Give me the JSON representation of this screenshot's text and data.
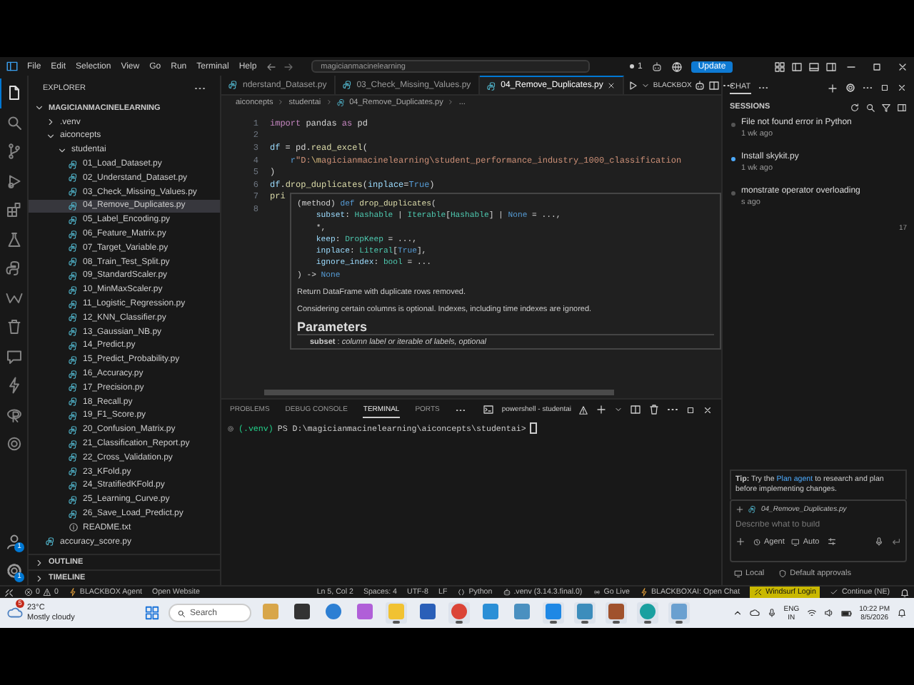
{
  "title_bar": {
    "menu": [
      "File",
      "Edit",
      "Selection",
      "View",
      "Go",
      "Run",
      "Terminal",
      "Help"
    ],
    "search": "magicianmacinelearning",
    "notification_count": "1",
    "update_button": "Update"
  },
  "activity_bar": {
    "items": [
      {
        "kind": "files",
        "selected": true
      },
      {
        "kind": "search",
        "selected": false
      },
      {
        "kind": "branch",
        "selected": false
      },
      {
        "kind": "debug",
        "selected": false
      },
      {
        "kind": "extensions",
        "selected": false
      },
      {
        "kind": "flask",
        "selected": false
      },
      {
        "kind": "python",
        "selected": false
      },
      {
        "kind": "zigzag",
        "selected": false
      },
      {
        "kind": "trash",
        "selected": false
      },
      {
        "kind": "chat",
        "selected": false
      },
      {
        "kind": "bolt",
        "selected": false
      },
      {
        "kind": "rlogo",
        "selected": false
      },
      {
        "kind": "ring",
        "selected": false
      }
    ],
    "bottom": [
      {
        "kind": "account",
        "badge": "1"
      },
      {
        "kind": "gear",
        "badge": "1"
      }
    ]
  },
  "sidebar": {
    "title": "EXPLORER",
    "tree": [
      {
        "label": "MAGICIANMACINELEARNING",
        "kind": "root",
        "expanded": true,
        "selected": false,
        "children": [
          {
            "label": ".venv",
            "kind": "folder",
            "expanded": false,
            "selected": false
          },
          {
            "label": "aiconcepts",
            "kind": "folder",
            "expanded": true,
            "selected": false,
            "children": [
              {
                "label": "studentai",
                "kind": "folder",
                "expanded": true,
                "selected": false,
                "children": [
                  {
                    "label": "01_Load_Dataset.py",
                    "kind": "python",
                    "selected": false
                  },
                  {
                    "label": "02_Understand_Dataset.py",
                    "kind": "python",
                    "selected": false
                  },
                  {
                    "label": "03_Check_Missing_Values.py",
                    "kind": "python",
                    "selected": false
                  },
                  {
                    "label": "04_Remove_Duplicates.py",
                    "kind": "python",
                    "selected": true
                  },
                  {
                    "label": "05_Label_Encoding.py",
                    "kind": "python",
                    "selected": false
                  },
                  {
                    "label": "06_Feature_Matrix.py",
                    "kind": "python",
                    "selected": false
                  },
                  {
                    "label": "07_Target_Variable.py",
                    "kind": "python",
                    "selected": false
                  },
                  {
                    "label": "08_Train_Test_Split.py",
                    "kind": "python",
                    "selected": false
                  },
                  {
                    "label": "09_StandardScaler.py",
                    "kind": "python",
                    "selected": false
                  },
                  {
                    "label": "10_MinMaxScaler.py",
                    "kind": "python",
                    "selected": false
                  },
                  {
                    "label": "11_Logistic_Regression.py",
                    "kind": "python",
                    "selected": false
                  },
                  {
                    "label": "12_KNN_Classifier.py",
                    "kind": "python",
                    "selected": false
                  },
                  {
                    "label": "13_Gaussian_NB.py",
                    "kind": "python",
                    "selected": false
                  },
                  {
                    "label": "14_Predict.py",
                    "kind": "python",
                    "selected": false
                  },
                  {
                    "label": "15_Predict_Probability.py",
                    "kind": "python",
                    "selected": false
                  },
                  {
                    "label": "16_Accuracy.py",
                    "kind": "python",
                    "selected": false
                  },
                  {
                    "label": "17_Precision.py",
                    "kind": "python",
                    "selected": false
                  },
                  {
                    "label": "18_Recall.py",
                    "kind": "python",
                    "selected": false
                  },
                  {
                    "label": "19_F1_Score.py",
                    "kind": "python",
                    "selected": false
                  },
                  {
                    "label": "20_Confusion_Matrix.py",
                    "kind": "python",
                    "selected": false
                  },
                  {
                    "label": "21_Classification_Report.py",
                    "kind": "python",
                    "selected": false
                  },
                  {
                    "label": "22_Cross_Validation.py",
                    "kind": "python",
                    "selected": false
                  },
                  {
                    "label": "23_KFold.py",
                    "kind": "python",
                    "selected": false
                  },
                  {
                    "label": "24_StratifiedKFold.py",
                    "kind": "python",
                    "selected": false
                  },
                  {
                    "label": "25_Learning_Curve.py",
                    "kind": "python",
                    "selected": false
                  },
                  {
                    "label": "26_Save_Load_Predict.py",
                    "kind": "python",
                    "selected": false
                  },
                  {
                    "label": "README.txt",
                    "kind": "text",
                    "selected": false
                  }
                ]
              }
            ]
          },
          {
            "label": "accuracy_score.py",
            "kind": "python",
            "selected": false
          }
        ]
      }
    ],
    "sections": [
      {
        "label": "OUTLINE",
        "expanded": false
      },
      {
        "label": "TIMELINE",
        "expanded": false
      }
    ]
  },
  "editor": {
    "tabs": [
      {
        "label": "nderstand_Dataset.py",
        "selected": false
      },
      {
        "label": "03_Check_Missing_Values.py",
        "selected": false
      },
      {
        "label": "04_Remove_Duplicates.py",
        "selected": true
      }
    ],
    "tab_action": "BLACKBOX",
    "breadcrumb": [
      "aiconcepts",
      "studentai",
      "04_Remove_Duplicates.py",
      "..."
    ],
    "lines": [
      {
        "number": "1",
        "tokens": [
          {
            "kind": "keyword",
            "text": "import"
          },
          {
            "kind": "plain",
            "text": " pandas "
          },
          {
            "kind": "keyword",
            "text": "as"
          },
          {
            "kind": "plain",
            "text": " pd"
          }
        ]
      },
      {
        "number": "2"
      },
      {
        "number": "3",
        "tokens": [
          {
            "kind": "var",
            "text": "df"
          },
          {
            "kind": "plain",
            "text": " = pd."
          },
          {
            "kind": "func",
            "text": "read_excel"
          },
          {
            "kind": "plain",
            "text": "("
          }
        ]
      },
      {
        "number": "4",
        "indented": true,
        "tokens": [
          {
            "kind": "const",
            "text": "r"
          },
          {
            "kind": "string",
            "text": "\"D:"
          },
          {
            "kind": "escape",
            "text": "\\m"
          },
          {
            "kind": "string",
            "text": "agicianmacinelearning\\student_performance_industry_1000_classification"
          }
        ]
      },
      {
        "number": "5",
        "tokens": [
          {
            "kind": "plain",
            "text": ")"
          }
        ]
      },
      {
        "number": "6",
        "tokens": [
          {
            "kind": "var",
            "text": "df"
          },
          {
            "kind": "plain",
            "text": "."
          },
          {
            "kind": "func",
            "text": "drop_duplicates"
          },
          {
            "kind": "plain",
            "text": "("
          },
          {
            "kind": "var",
            "text": "inplace"
          },
          {
            "kind": "plain",
            "text": "="
          },
          {
            "kind": "const",
            "text": "True"
          },
          {
            "kind": "plain",
            "text": ")"
          }
        ]
      },
      {
        "number": "7",
        "tokens": [
          {
            "kind": "func",
            "text": "pri"
          }
        ]
      },
      {
        "number": "8"
      }
    ],
    "hover": {
      "signature": [
        [
          {
            "kind": "plain",
            "text": "(method) "
          },
          {
            "kind": "const",
            "text": "def"
          },
          {
            "kind": "func",
            "text": " drop_duplicates"
          },
          {
            "kind": "plain",
            "text": "("
          }
        ],
        [
          {
            "kind": "var",
            "text": "    subset"
          },
          {
            "kind": "plain",
            "text": ": "
          },
          {
            "kind": "type",
            "text": "Hashable"
          },
          {
            "kind": "plain",
            "text": " | "
          },
          {
            "kind": "type",
            "text": "Iterable"
          },
          {
            "kind": "plain",
            "text": "["
          },
          {
            "kind": "type",
            "text": "Hashable"
          },
          {
            "kind": "plain",
            "text": "] | "
          },
          {
            "kind": "const",
            "text": "None"
          },
          {
            "kind": "plain",
            "text": " = ...,"
          }
        ],
        [
          {
            "kind": "plain",
            "text": "    *,"
          }
        ],
        [
          {
            "kind": "var",
            "text": "    keep"
          },
          {
            "kind": "plain",
            "text": ": "
          },
          {
            "kind": "type",
            "text": "DropKeep"
          },
          {
            "kind": "plain",
            "text": " = ...,"
          }
        ],
        [
          {
            "kind": "var",
            "text": "    inplace"
          },
          {
            "kind": "plain",
            "text": ": "
          },
          {
            "kind": "type",
            "text": "Literal"
          },
          {
            "kind": "plain",
            "text": "["
          },
          {
            "kind": "const",
            "text": "True"
          },
          {
            "kind": "plain",
            "text": "],"
          }
        ],
        [
          {
            "kind": "var",
            "text": "    ignore_index"
          },
          {
            "kind": "plain",
            "text": ": "
          },
          {
            "kind": "type",
            "text": "bool"
          },
          {
            "kind": "plain",
            "text": " = ..."
          }
        ],
        [
          {
            "kind": "plain",
            "text": ") -> "
          },
          {
            "kind": "const",
            "text": "None"
          }
        ]
      ],
      "description": [
        "Return DataFrame with duplicate rows removed.",
        "Considering certain columns is optional. Indexes, including time indexes are ignored."
      ],
      "heading": "Parameters",
      "param": "**subset** : *column label or iterable of labels, optional*"
    },
    "panel": {
      "tabs": [
        {
          "label": "PROBLEMS",
          "selected": false
        },
        {
          "label": "DEBUG CONSOLE",
          "selected": false
        },
        {
          "label": "TERMINAL",
          "selected": true
        },
        {
          "label": "PORTS",
          "selected": false
        }
      ],
      "terminal_name": "powershell - studentai",
      "terminal_lines": [
        {
          "env": "(.venv)",
          "prompt": "PS D:\\magicianmacinelearning\\aiconcepts\\studentai>"
        }
      ]
    }
  },
  "chat": {
    "tab": "CHAT",
    "sessions_title": "SESSIONS",
    "sessions": [
      {
        "title": "File not found error in Python",
        "time": "1 wk ago",
        "unread": false
      },
      {
        "title": "Install skykit.py",
        "time": "1 wk ago",
        "unread": true
      },
      {
        "title": "monstrate operator overloading",
        "time": "s ago",
        "unread": false
      }
    ],
    "marker_text": "17",
    "tip": {
      "lead": "**Tip:** Try the ",
      "link": "Plan agent",
      "rest": " to research and plan before implementing changes."
    },
    "attachment": "04_Remove_Duplicates.py",
    "placeholder": "Describe what to build",
    "mode": "Agent",
    "model": "Auto",
    "footer": [
      "Local",
      "Default approvals"
    ]
  },
  "status_bar": {
    "errors": "0",
    "warnings": "0",
    "left": [
      "BLACKBOX Agent",
      "Open Website"
    ],
    "right": [
      {
        "kind": "text",
        "text": "Ln 5, Col 2"
      },
      {
        "kind": "text",
        "text": "Spaces: 4"
      },
      {
        "kind": "text",
        "text": "UTF-8"
      },
      {
        "kind": "text",
        "text": "LF"
      },
      {
        "kind": "language",
        "text": "Python"
      },
      {
        "kind": "env",
        "text": ".venv (3.14.3.final.0)"
      },
      {
        "kind": "live",
        "text": "Go Live"
      },
      {
        "kind": "bolt",
        "text": "BLACKBOXAI: Open Chat"
      },
      {
        "kind": "highlight",
        "text": "Windsurf Login"
      },
      {
        "kind": "check",
        "text": "Continue (NE)"
      }
    ]
  },
  "taskbar": {
    "weather": {
      "badge": "5",
      "temperature": "23°C",
      "condition": "Mostly cloudy"
    },
    "search": "Search",
    "apps": [
      {
        "kind": "news",
        "open": false
      },
      {
        "kind": "terminal",
        "open": false
      },
      {
        "kind": "help",
        "open": false
      },
      {
        "kind": "copilot",
        "open": false
      },
      {
        "kind": "folder",
        "open": true
      },
      {
        "kind": "store",
        "open": false
      },
      {
        "kind": "chrome",
        "open": true
      },
      {
        "kind": "snip",
        "open": false
      },
      {
        "kind": "cloud",
        "open": false
      },
      {
        "kind": "code",
        "open": true
      },
      {
        "kind": "photos",
        "open": true
      },
      {
        "kind": "game",
        "open": true
      },
      {
        "kind": "edge",
        "open": true
      },
      {
        "kind": "paint",
        "open": true
      }
    ],
    "tray": {
      "language": "ENG",
      "region": "IN",
      "time": "10:22 PM",
      "date": "8/5/2026"
    }
  }
}
